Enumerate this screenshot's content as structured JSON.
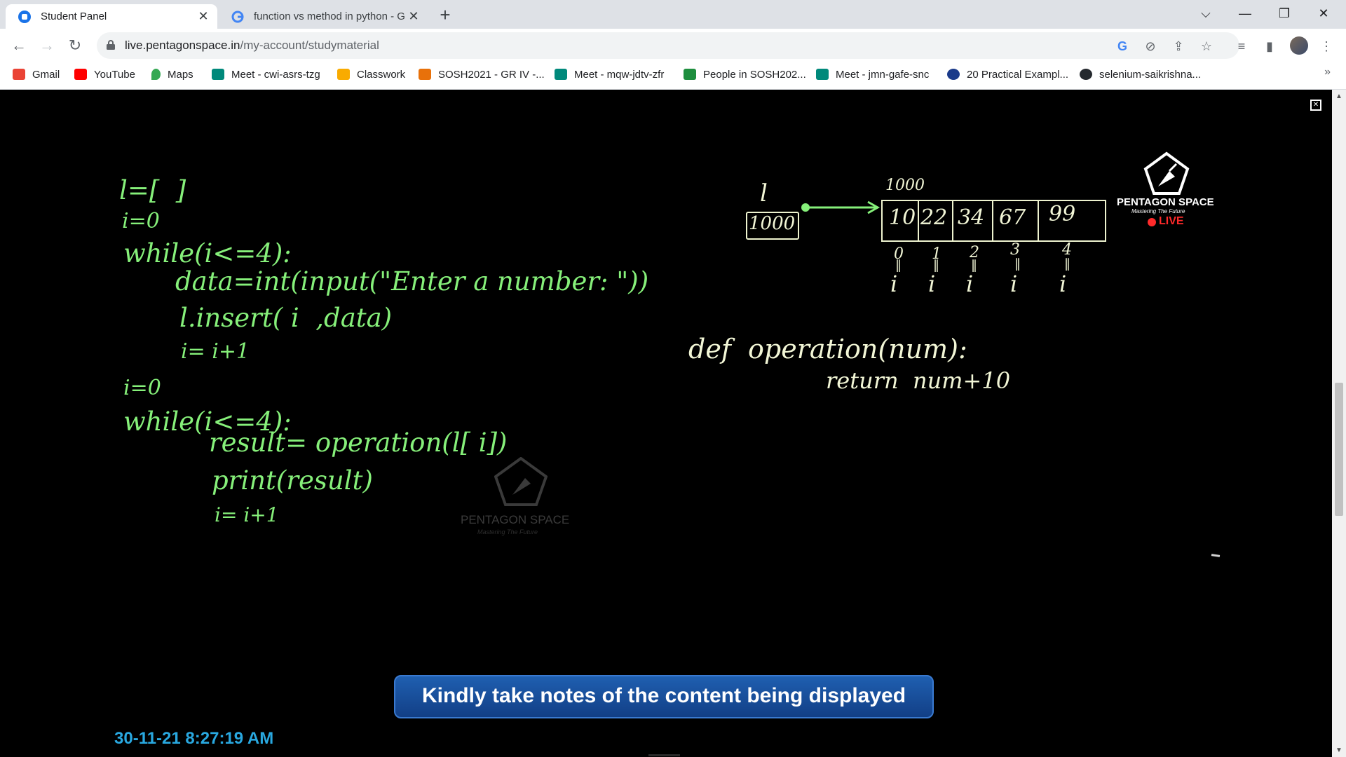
{
  "browser": {
    "tabs": [
      {
        "title": "Student Panel",
        "active": true,
        "icon": "student-panel-icon"
      },
      {
        "title": "function vs method in python - G",
        "active": false,
        "icon": "google-g-icon"
      }
    ],
    "new_tab": "+",
    "window_controls": {
      "tab_search": "⌵",
      "minimize": "—",
      "restore": "❐",
      "close": "✕"
    },
    "url": {
      "host": "live.pentagonspace.in",
      "path": "/my-account/studymaterial"
    },
    "bookmarks": [
      {
        "label": "Gmail",
        "icon": "gmail-icon",
        "color": "#ea4335"
      },
      {
        "label": "YouTube",
        "icon": "youtube-icon",
        "color": "#ff0000"
      },
      {
        "label": "Maps",
        "icon": "maps-icon",
        "color": "#34a853"
      },
      {
        "label": "Meet - cwi-asrs-tzg",
        "icon": "meet-icon",
        "color": "#00897b"
      },
      {
        "label": "Classwork",
        "icon": "classroom-icon",
        "color": "#f9ab00"
      },
      {
        "label": "SOSH2021 - GR IV -...",
        "icon": "classroom-icon",
        "color": "#e8710a"
      },
      {
        "label": "Meet - mqw-jdtv-zfr",
        "icon": "meet-icon",
        "color": "#00897b"
      },
      {
        "label": "People in SOSH202...",
        "icon": "classroom-icon",
        "color": "#1e8e3e"
      },
      {
        "label": "Meet - jmn-gafe-snc",
        "icon": "meet-icon",
        "color": "#00897b"
      },
      {
        "label": "20 Practical Exampl...",
        "icon": "site-icon",
        "color": "#1a3a8a"
      },
      {
        "label": "selenium-saikrishna...",
        "icon": "github-icon",
        "color": "#24292e"
      }
    ],
    "bookmarks_more": "»"
  },
  "lecture": {
    "code_left": [
      "l=[  ]",
      "i=0",
      "while(i<=4):",
      "data=int(input(\"Enter a number: \"))",
      "l.insert( i  ,data)",
      "i= i+1",
      "i=0",
      "while(i<=4):",
      "result= operation(l[ i])",
      "print(result)",
      "i= i+1"
    ],
    "diagram": {
      "var_name": "l",
      "var_box_value": "1000",
      "address_label": "1000",
      "list_values": [
        "10",
        "22",
        "34",
        "67",
        "99"
      ],
      "indices": [
        "0",
        "1",
        "2",
        "3",
        "4"
      ],
      "index_var": "i"
    },
    "code_right": [
      "def  operation(num):",
      "return  num+10"
    ],
    "logo": {
      "name": "PENTAGON SPACE",
      "tagline": "Mastering The Future",
      "live": "LIVE"
    },
    "watermark": {
      "name": "PENTAGON SPACE",
      "tagline": "Mastering The Future"
    },
    "banner": "Kindly take notes of the content being displayed",
    "timestamp": "30-11-21 8:27:19 AM"
  }
}
